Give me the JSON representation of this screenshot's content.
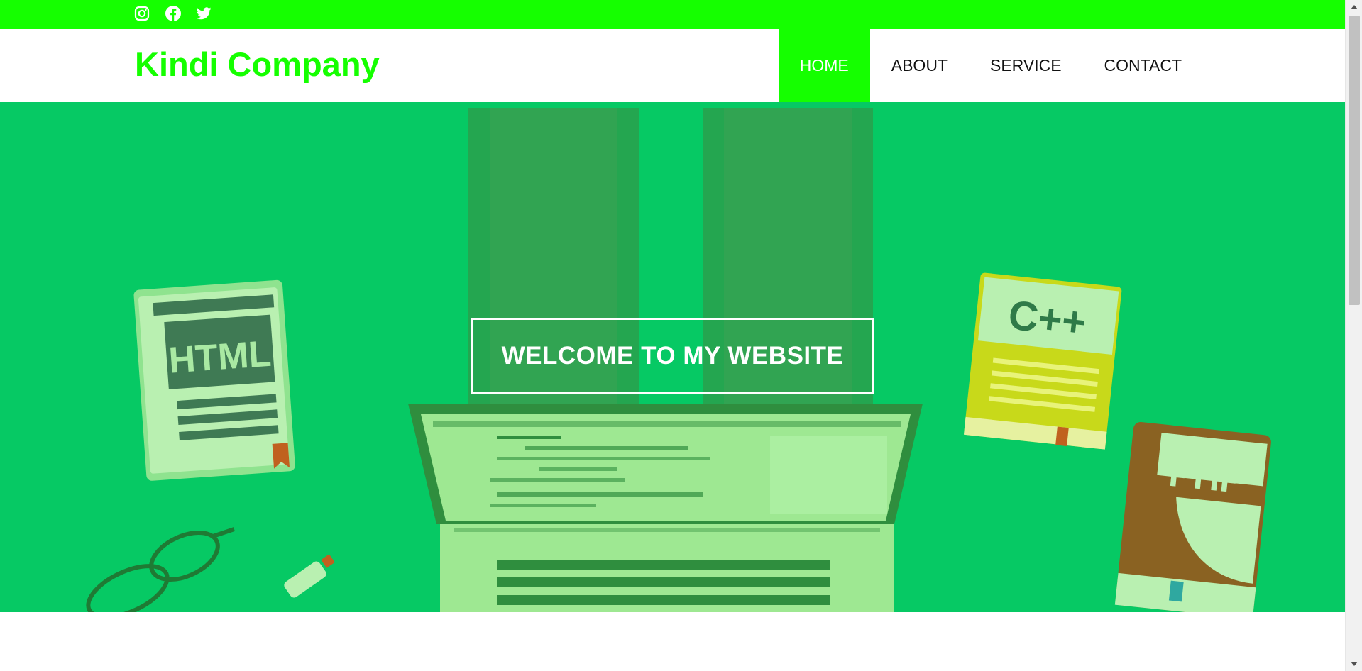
{
  "topbar": {
    "color": "#15ff00",
    "icons": [
      "instagram-icon",
      "facebook-icon",
      "twitter-icon"
    ]
  },
  "header": {
    "brand": "Kindi Company",
    "brand_color": "#15ff00",
    "nav": [
      {
        "label": "HOME",
        "active": true
      },
      {
        "label": "ABOUT",
        "active": false
      },
      {
        "label": "SERVICE",
        "active": false
      },
      {
        "label": "CONTACT",
        "active": false
      }
    ]
  },
  "hero": {
    "heading": "WELCOME TO MY WEBSITE",
    "overlay_color": "#06c964",
    "illustration": {
      "html_book": "HTML",
      "cpp_book": "C++",
      "php_book": "PHP"
    }
  },
  "scrollbar": {
    "up_icon": "triangle-up-icon",
    "down_icon": "triangle-down-icon"
  }
}
